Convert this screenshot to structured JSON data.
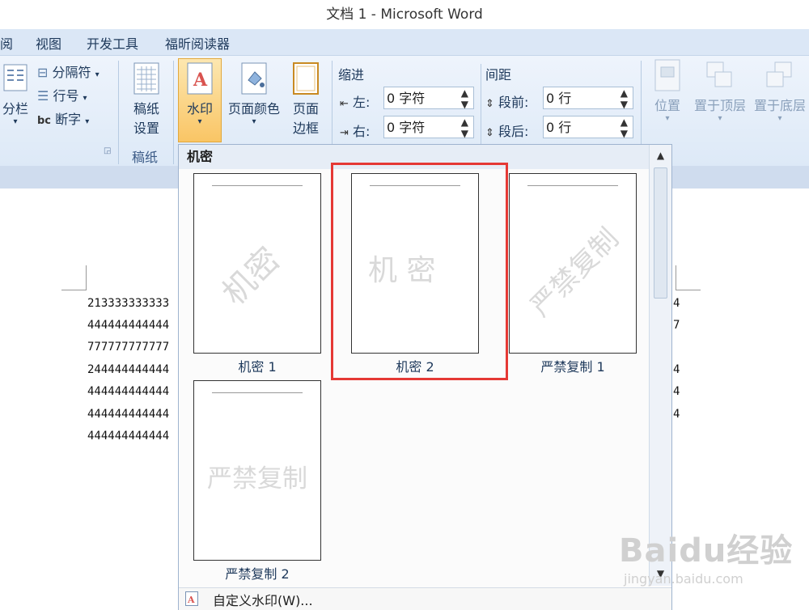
{
  "window": {
    "title": "文档 1 - Microsoft Word"
  },
  "menu": {
    "items": [
      "阅",
      "视图",
      "开发工具",
      "福昕阅读器"
    ]
  },
  "ribbon": {
    "page_setup": {
      "columns_label": "分栏",
      "breaks_label": "分隔符",
      "line_numbers_label": "行号",
      "hyphenation_label": "断字"
    },
    "manuscript": {
      "button_line1": "稿纸",
      "button_line2": "设置",
      "group_label": "稿纸"
    },
    "page_background": {
      "watermark_label": "水印",
      "page_color_label": "页面颜色",
      "page_border_line1": "页面",
      "page_border_line2": "边框"
    },
    "paragraph": {
      "indent_title": "缩进",
      "indent_left_label": "左:",
      "indent_left_value": "0 字符",
      "indent_right_label": "右:",
      "indent_right_value": "0 字符",
      "spacing_title": "间距",
      "space_before_label": "段前:",
      "space_before_value": "0 行",
      "space_after_label": "段后:",
      "space_after_value": "0 行"
    },
    "arrange": {
      "position_label": "位置",
      "bring_front_label": "置于顶层",
      "send_back_label": "置于底层"
    }
  },
  "document": {
    "lines": [
      "213333333333",
      "444444444444",
      "777777777777",
      "244444444444",
      "444444444444",
      "444444444444",
      "444444444444"
    ],
    "right_edge_chars": [
      "4",
      "7",
      "4",
      "4",
      "4"
    ]
  },
  "watermark_gallery": {
    "section_header": "机密",
    "items": [
      {
        "caption": "机密 1",
        "text": "机密"
      },
      {
        "caption": "机密 2",
        "text": "机 密"
      },
      {
        "caption": "严禁复制 1",
        "text": "严禁复制"
      },
      {
        "caption": "严禁复制 2",
        "text": "严禁复制"
      }
    ],
    "custom_label": "自定义水印(W)..."
  },
  "overlay": {
    "logo_text": "Baidu经验",
    "logo_url_text": "jingyan.baidu.com"
  },
  "colors": {
    "ribbon": "#dde9f7",
    "highlight": "#e53935",
    "accent": "#1e395b"
  }
}
